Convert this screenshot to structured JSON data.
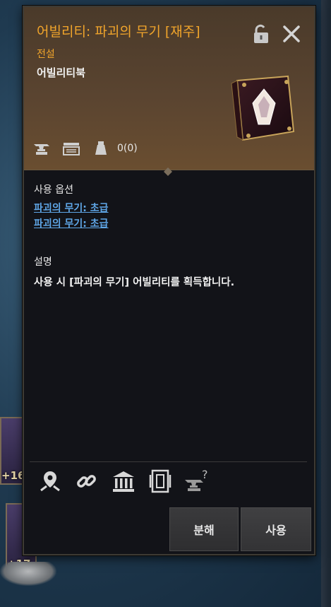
{
  "item": {
    "title": "어빌리티: 파괴의 무기 [재주]",
    "grade": "전설",
    "type": "어빌리티북",
    "durability": "0(0)"
  },
  "options": {
    "label": "사용 옵션",
    "links": [
      "파괴의 무기: 초급",
      "파괴의 무기: 초급"
    ]
  },
  "description": {
    "label": "설명",
    "text": "사용 시 [파괴의 무기] 어빌리티를 획득합니다."
  },
  "buttons": {
    "disassemble": "분해",
    "use": "사용"
  },
  "background": {
    "slot_numbers": [
      "+16",
      "+17"
    ]
  },
  "icons": {
    "header": [
      "lock-icon",
      "close-icon",
      "anvil-icon",
      "tradeable-icon",
      "weight-icon"
    ],
    "footer": [
      "location-pin-icon",
      "link-icon",
      "bank-icon",
      "storage-icon",
      "anvil-question-icon"
    ]
  },
  "colors": {
    "title": "#f1a52b",
    "link": "#5fa6e6",
    "panel_bg": "#121318"
  }
}
